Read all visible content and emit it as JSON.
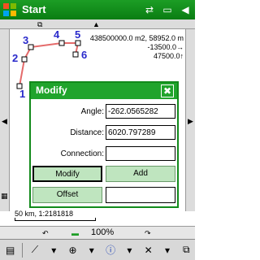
{
  "titlebar": {
    "title": "Start"
  },
  "map": {
    "coords": {
      "line1": "438500000.0 m2, 58952.0 m",
      "line2": "-13500.0→",
      "line3": "47500.0↑"
    },
    "points": [
      "1",
      "2",
      "3",
      "4",
      "5",
      "6"
    ],
    "scale": "50 km, 1:2181818"
  },
  "dialog": {
    "title": "Modify",
    "close": "✖",
    "angle_label": "Angle:",
    "angle_value": "-262.0565282",
    "distance_label": "Distance:",
    "distance_value": "6020.797289",
    "connection_label": "Connection:",
    "connection_value": "",
    "modify_button": "Modify",
    "add_button": "Add",
    "offset_button": "Offset",
    "offset_value": ""
  },
  "statusbar": {
    "zoom": "100%"
  },
  "colors": {
    "title_green": "#0a7d12",
    "dialog_green": "#20a42c",
    "button_green": "#bfe5bf",
    "point_blue": "#2a2acb",
    "polyline_red": "#e46a6a"
  }
}
